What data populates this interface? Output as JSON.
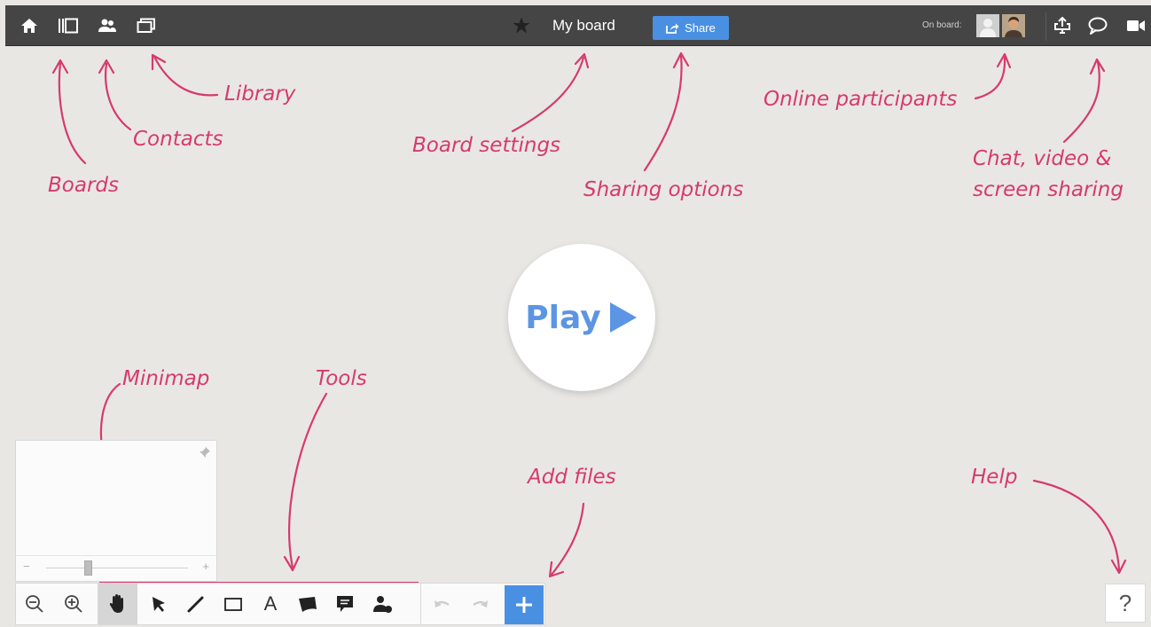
{
  "topbar": {
    "icons": {
      "home": "home-icon",
      "boards": "boards-icon",
      "contacts": "contacts-icon",
      "library": "library-icon"
    },
    "board_title": "My board",
    "share_label": "Share",
    "on_board_label": "On board:"
  },
  "annotations": {
    "boards": "Boards",
    "contacts": "Contacts",
    "library": "Library",
    "board_settings": "Board settings",
    "sharing_options": "Sharing options",
    "online_participants": "Online participants",
    "chat_line1": "Chat, video &",
    "chat_line2": "screen sharing",
    "minimap": "Minimap",
    "tools": "Tools",
    "add_files": "Add files",
    "help": "Help"
  },
  "play": {
    "label": "Play"
  },
  "minimap": {
    "minus": "−",
    "plus": "+"
  },
  "toolbar": {
    "text_tool": "A"
  },
  "help": {
    "label": "?"
  },
  "colors": {
    "topbar": "#454545",
    "accent_blue": "#4a90e2",
    "annotation_pink": "#d63a6e",
    "canvas": "#e9e7e4"
  }
}
